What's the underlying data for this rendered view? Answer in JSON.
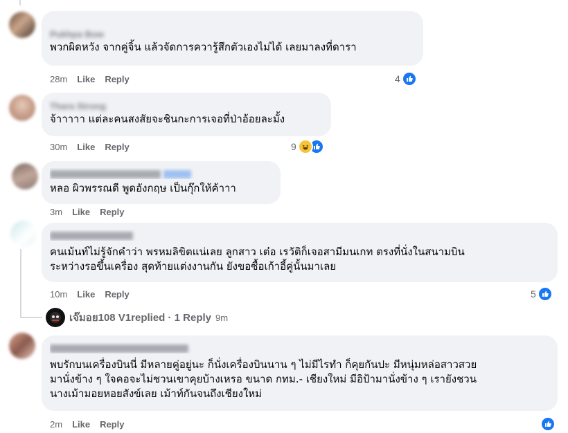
{
  "comments": [
    {
      "author": "Pukhpa Bow",
      "text": "พวกผิดหวัง จากคู่จิ้น แล้วจัดการควารู้สึกตัวเองไม่ได้ เลยมาลงที่ดารา",
      "time": "28m",
      "like": "Like",
      "reply": "Reply",
      "reaction_count": "4"
    },
    {
      "author": "Thara Strong",
      "text": "จ้าาาาา แต่ละคนสงสัยจะชินกะการเจอที่ป่าอ้อยละมั้ง",
      "time": "30m",
      "like": "Like",
      "reply": "Reply",
      "reaction_count": "9"
    },
    {
      "author": "",
      "text": "หลอ ผิวพรรณดี พูดอังกฤษ เป็นกุ๊กให้ค้าาา",
      "time": "3m",
      "like": "Like",
      "reply": "Reply",
      "reaction_count": ""
    },
    {
      "author": "",
      "text": "คนเม้นท์ไม่รู้จักคำว่า พรหมลิขิตแน่เลย ลูกสาว เต๋อ เรวัติก็เจอสามีมนเกท ตรงที่นั่งในสนามบิน\nระหว่างรอขึ้นเครื่อง สุดท้ายแต่งงานกัน ยังขอซื้อเก้าอี้คู่นั้นมาเลย",
      "time": "10m",
      "like": "Like",
      "reply": "Reply",
      "reaction_count": "5"
    },
    {
      "author": "",
      "text": "พบรักบนเครื่องบินนี่ มีหลายคู่อยู่นะ ก็นั่งเครื่องบินนาน ๆ ไม่มีไรทำ ก็คุยกันปะ มีหนุ่มหล่อสาวสวย\nมานั่งข้าง ๆ ใจคอจะไม่ชวนเขาคุยบ้างเหรอ ขนาด กทม.- เชียงใหม่ มีอิป้ามานั่งข้าง ๆ เรายังชวน\nนางเม้ามอยหอยสังข์เลย เม้าท์กันจนถึงเชียงใหม่",
      "time": "2m",
      "like": "Like",
      "reply": "Reply",
      "reaction_count": ""
    }
  ],
  "reply_summary": {
    "name": "เจ๊มอย108 V1",
    "text": " replied · 1 Reply",
    "time": "9m"
  },
  "icons": [
    "like-icon",
    "haha-icon",
    "thumbs-up-icon"
  ],
  "colors": {
    "accent": "#1877f2",
    "bubble": "#f0f2f5",
    "meta": "#65676b"
  }
}
